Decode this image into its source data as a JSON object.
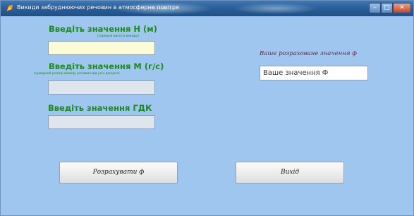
{
  "window": {
    "title": "Викиди забруднюючих речовин в атмосферне повітря"
  },
  "form": {
    "h_label": "Введіть значення Н (м)",
    "h_hint": "(середня висота викиду)",
    "h_value": "",
    "m_label": "Введіть значення М (г/с)",
    "m_hint": "(сумарний розмір викиду речовин від усіх джерел)",
    "m_value": "",
    "gdk_label": "Введіть значення ГДК",
    "gdk_value": ""
  },
  "result": {
    "label": "Ваше розраховане значення ф",
    "value": "Ваше значення Ф"
  },
  "buttons": {
    "calculate": "Розрахувати ф",
    "exit": "Вихід"
  },
  "colors": {
    "window_bg": "#9fc6ee",
    "label_green": "#1c8a1c",
    "result_label": "#7b1a3e"
  }
}
